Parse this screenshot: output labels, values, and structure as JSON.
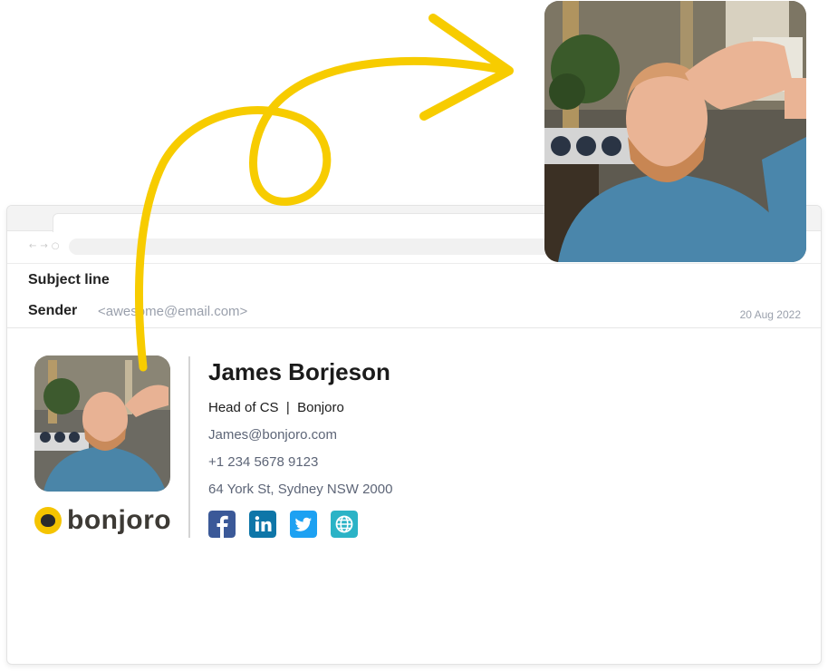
{
  "email": {
    "subject_label": "Subject line",
    "sender_label": "Sender",
    "sender_address": "<awesome@email.com>",
    "date": "20 Aug 2022"
  },
  "signature": {
    "name": "James Borjeson",
    "role": "Head of CS  |  Bonjoro",
    "email": "James@bonjoro.com",
    "phone": "+1 234 5678 9123",
    "address": "64 York St, Sydney NSW 2000",
    "brand": "bonjoro",
    "socials": [
      "facebook-icon",
      "linkedin-icon",
      "twitter-icon",
      "globe-icon"
    ]
  },
  "colors": {
    "arrow": "#f7cc00",
    "facebook": "#3b5998",
    "linkedin": "#0e76a8",
    "twitter": "#1da1f2",
    "website": "#2bb3c6",
    "brand_yellow": "#f5c400"
  }
}
